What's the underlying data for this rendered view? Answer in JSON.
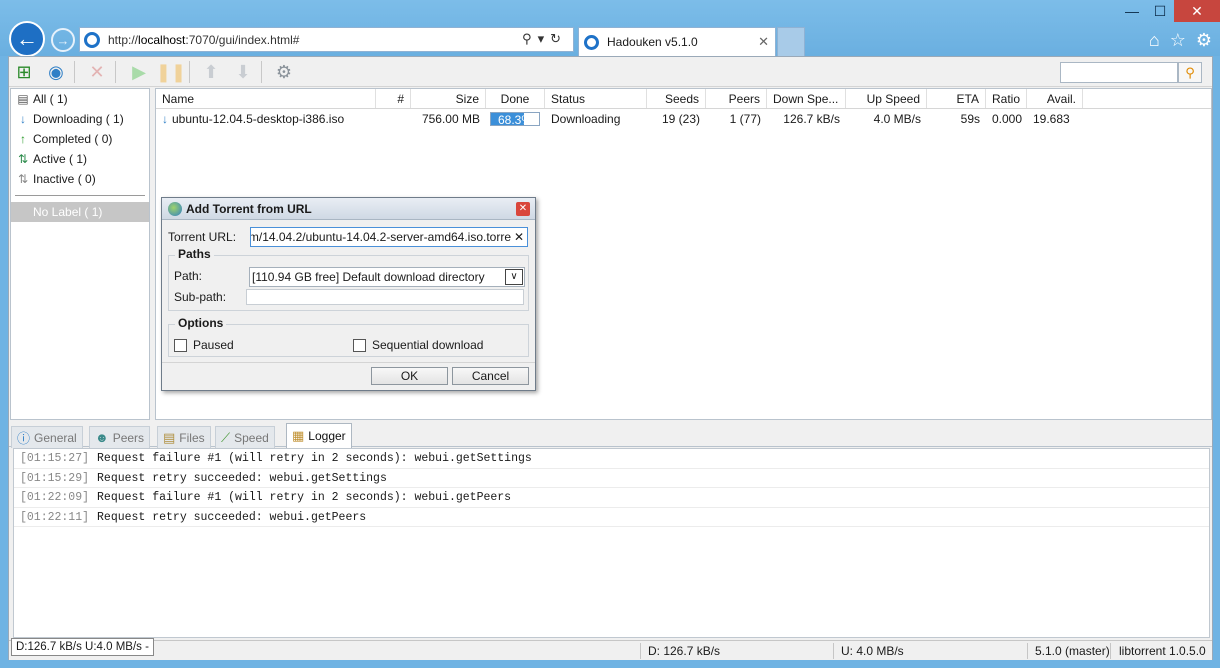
{
  "browser": {
    "url_prefix": "http://",
    "url_host": "localhost",
    "url_rest": ":7070/gui/index.html#",
    "tab_title": "Hadouken v5.1.0",
    "tab_close": "✕"
  },
  "window_buttons": {
    "minimize": "—",
    "maximize": "☐",
    "close": "✕"
  },
  "ie_tools": {
    "home": "⌂",
    "favorites": "☆",
    "settings": "⚙"
  },
  "search": {
    "placeholder": ""
  },
  "labels": [
    {
      "icon": "all-icon",
      "text": "All ( 1)"
    },
    {
      "icon": "downloading-icon",
      "text": "Downloading ( 1)"
    },
    {
      "icon": "completed-icon",
      "text": "Completed ( 0)"
    },
    {
      "icon": "active-icon",
      "text": "Active ( 1)"
    },
    {
      "icon": "inactive-icon",
      "text": "Inactive ( 0)"
    }
  ],
  "no_label": "No Label ( 1)",
  "columns": [
    "Name",
    "#",
    "Size",
    "Done",
    "Status",
    "Seeds",
    "Peers",
    "Down Spe...",
    "Up Speed",
    "ETA",
    "Ratio",
    "Avail."
  ],
  "torrents": [
    {
      "name": "ubuntu-12.04.5-desktop-i386.iso",
      "num": "",
      "size": "756.00 MB",
      "done": "68.3%",
      "done_fraction": 0.683,
      "status": "Downloading",
      "seeds": "19 (23)",
      "peers": "1 (77)",
      "down": "126.7 kB/s",
      "up": "4.0 MB/s",
      "eta": "59s",
      "ratio": "0.000",
      "avail": "19.683"
    }
  ],
  "dialog": {
    "title": "Add Torrent from URL",
    "url_label": "Torrent URL:",
    "url_value": "m/14.04.2/ubuntu-14.04.2-server-amd64.iso.torre",
    "paths_legend": "Paths",
    "path_label": "Path:",
    "path_value": "[110.94 GB free] Default download directory",
    "subpath_label": "Sub-path:",
    "options_legend": "Options",
    "paused_label": "Paused",
    "sequential_label": "Sequential download",
    "ok": "OK",
    "cancel": "Cancel"
  },
  "bottom_tabs": [
    {
      "label": "General",
      "active": false
    },
    {
      "label": "Peers",
      "active": false
    },
    {
      "label": "Files",
      "active": false
    },
    {
      "label": "Speed",
      "active": false
    },
    {
      "label": "Logger",
      "active": true
    }
  ],
  "log": [
    {
      "time": "[01:15:27]",
      "msg": "Request failure #1 (will retry in 2 seconds): webui.getSettings"
    },
    {
      "time": "[01:15:29]",
      "msg": "Request retry succeeded: webui.getSettings"
    },
    {
      "time": "[01:22:09]",
      "msg": "Request failure #1 (will retry in 2 seconds): webui.getPeers"
    },
    {
      "time": "[01:22:11]",
      "msg": "Request retry succeeded: webui.getPeers"
    }
  ],
  "status": {
    "tooltip": "D:126.7 kB/s U:4.0 MB/s -",
    "down": "D: 126.7 kB/s",
    "up": "U: 4.0 MB/s",
    "version": "5.1.0 (master)",
    "lib": "libtorrent 1.0.5.0"
  },
  "colors": {
    "accent": "#3b8fd9",
    "ie_blue": "#1e6fc4",
    "close_red": "#c7463e"
  }
}
